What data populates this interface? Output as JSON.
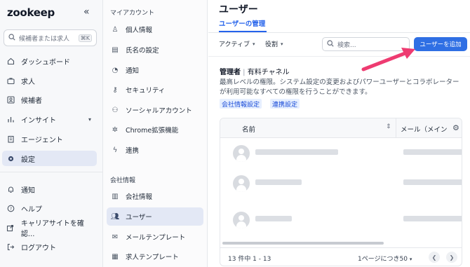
{
  "sidebar": {
    "logo": "zookeep",
    "search_placeholder": "候補者または求人",
    "search_shortcut": "⌘K",
    "items": [
      {
        "label": "ダッシュボード",
        "icon": "home-icon"
      },
      {
        "label": "求人",
        "icon": "briefcase-icon"
      },
      {
        "label": "候補者",
        "icon": "candidates-icon"
      },
      {
        "label": "インサイト",
        "icon": "bar-chart-icon"
      },
      {
        "label": "エージェント",
        "icon": "building-icon"
      },
      {
        "label": "設定",
        "icon": "settings-icon"
      }
    ],
    "bottom_items": [
      {
        "label": "通知",
        "icon": "bell-icon"
      },
      {
        "label": "ヘルプ",
        "icon": "help-icon"
      },
      {
        "label": "キャリアサイトを確認...",
        "icon": "external-link-icon"
      },
      {
        "label": "ログアウト",
        "icon": "logout-icon"
      }
    ]
  },
  "submenu": {
    "account_title": "マイアカウント",
    "account_items": [
      {
        "label": "個人情報",
        "icon": "user-icon"
      },
      {
        "label": "氏名の設定",
        "icon": "id-card-icon"
      },
      {
        "label": "通知",
        "icon": "bell-icon"
      },
      {
        "label": "セキュリティ",
        "icon": "key-icon"
      },
      {
        "label": "ソーシャルアカウント",
        "icon": "social-icon"
      },
      {
        "label": "Chrome拡張機能",
        "icon": "puzzle-icon"
      },
      {
        "label": "連携",
        "icon": "bolt-icon"
      }
    ],
    "company_title": "会社情報",
    "company_items": [
      {
        "label": "会社情報",
        "icon": "building-icon"
      },
      {
        "label": "ユーザー",
        "icon": "users-icon"
      },
      {
        "label": "メールテンプレート",
        "icon": "mail-icon"
      },
      {
        "label": "求人テンプレート",
        "icon": "template-icon"
      }
    ]
  },
  "main": {
    "title": "ユーザー",
    "tab": "ユーザーの管理",
    "filters": {
      "status": "アクティブ",
      "role": "役割"
    },
    "search_placeholder": "検索...",
    "add_button": "ユーザーを追加",
    "role_label": "管理者",
    "role_plan": "有料チャネル",
    "role_description": "最高レベルの権限。システム設定の変更およびパワーユーザーとコラボレーターが利用可能なすべての権限を行うことができます。",
    "chips": [
      "会社情報設定",
      "連携設定"
    ],
    "table": {
      "col_name": "名前",
      "col_mail": "メール（メイン",
      "rows": 3,
      "footer_count": "13 件中 1 - 13",
      "per_page": "1ページにつき50"
    }
  },
  "colors": {
    "accent": "#2f6fe4",
    "annotation": "#ee3b71"
  }
}
